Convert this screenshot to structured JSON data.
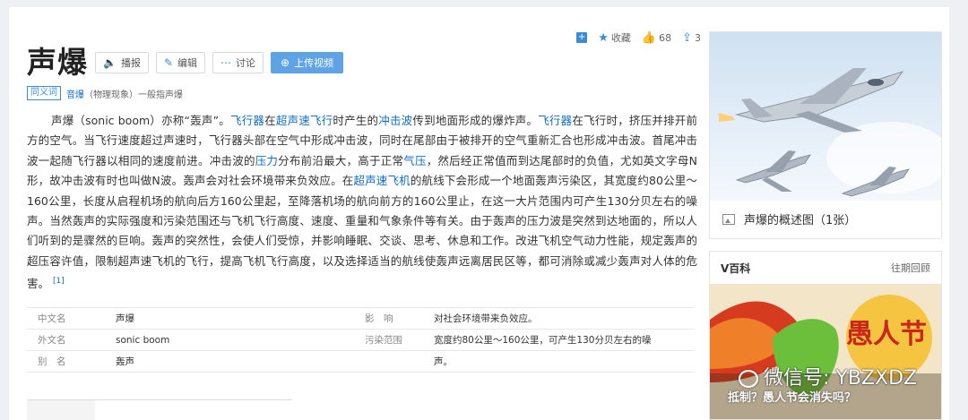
{
  "entry": {
    "title": "声爆",
    "buttons": {
      "broadcast": "播报",
      "edit": "编辑",
      "discuss": "讨论",
      "upload": "上传视频"
    },
    "stats": {
      "add_icon": "plus-icon",
      "favorite": "收藏",
      "likes": "68",
      "shares": "3"
    },
    "synonym": {
      "tag": "同义词",
      "link": "音爆",
      "note": "（物理现象）一般指声爆"
    }
  },
  "article": {
    "p1": "声爆（sonic boom）亦称“轰声”。",
    "l1": "飞行器",
    "p2": "在",
    "l2": "超声速飞行",
    "p3": "时产生的",
    "l3": "冲击波",
    "p4": "传到地面形成的爆炸声。",
    "l4": "飞行器",
    "p5": "在飞行时，挤压并排开前方的空气。当飞行速度超过声速时，飞行器头部在空气中形成冲击波，同时在尾部由于被排开的空气重新汇合也形成冲击波。首尾冲击波一起随飞行器以相同的速度前进。冲击波的",
    "l5": "压力",
    "p6": "分布前沿最大，高于正常",
    "l6": "气压",
    "p7": "，然后经正常值而到达尾部时的负值，尤如英文字母N形，故冲击波有时也叫做N波。轰声会对社会环境带来负效应。在",
    "l7": "超声速飞机",
    "p8": "的航线下会形成一个地面轰声污染区，其宽度约80公里～160公里，长度从启程机场的航向后方160公里起，至降落机场的航向前方的160公里止，在这一大片范围内可产生130分贝左右的噪声。当然轰声的实际强度和污染范围还与飞机飞行高度、速度、重量和气象条件等有关。由于轰声的压力波是突然到达地面的，所以人们听到的是骤然的巨响。轰声的突然性，会使人们受惊，并影响睡眠、交谈、思考、休息和工作。改进飞机空气动力性能，规定轰声的超压容许值，限制超声速飞机的飞行，提高飞机飞行高度，以及选择适当的航线使轰声远离居民区等，都可消除或减少轰声对人体的危害。",
    "ref": "[1]"
  },
  "basic_info": [
    {
      "k1": "中文名",
      "v1": "声爆",
      "k2": "影　响",
      "v2": "对社会环境带来负效应。"
    },
    {
      "k1": "外文名",
      "v1": "sonic boom",
      "k2": "污染范围",
      "v2": "宽度约80公里～160公里，可产生130分贝左右的噪"
    },
    {
      "k1": "别　名",
      "v1": "轰声",
      "k2": "",
      "v2": "声。"
    }
  ],
  "sidebar": {
    "summary_caption": "声爆的概述图（1张）",
    "vbaike": {
      "title": "V百科",
      "more": "往期回顾",
      "image_text": "愚人节",
      "caption": "抵制？愚人节会消失吗？",
      "watermark": "微信号: YBZXDZ"
    }
  },
  "colors": {
    "link": "#136ec2",
    "accent": "#3a8bd8",
    "upload_button": "#5fa3e4"
  }
}
